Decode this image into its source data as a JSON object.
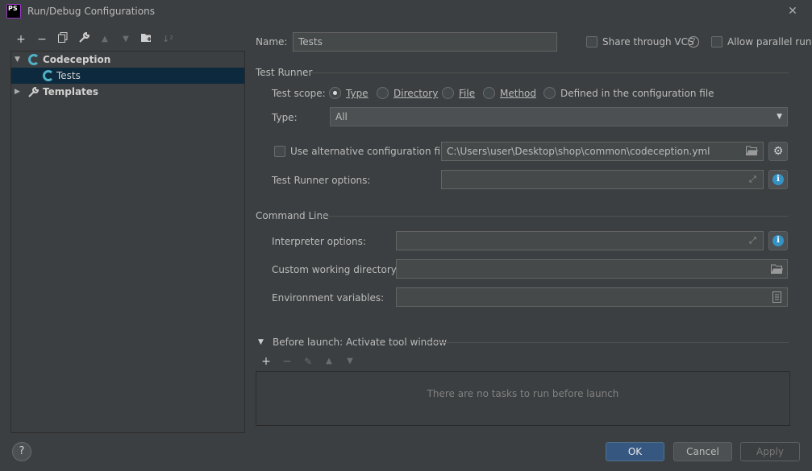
{
  "window": {
    "title": "Run/Debug Configurations",
    "logo_text": "PS"
  },
  "toolbar": {
    "icons": [
      "add-icon",
      "remove-icon",
      "copy-icon",
      "wrench-icon",
      "move-up-icon",
      "move-down-icon",
      "new-folder-icon",
      "sort-icon"
    ]
  },
  "tree": {
    "items": [
      {
        "label": "Codeception",
        "level": 0,
        "expanded": true
      },
      {
        "label": "Tests",
        "level": 1,
        "selected": true
      },
      {
        "label": "Templates",
        "level": 0,
        "expanded": false
      }
    ]
  },
  "config": {
    "name_label": "Name:",
    "name_value": "Tests",
    "share_vcs_label": "Share through VCS",
    "allow_parallel_label": "Allow parallel run"
  },
  "test_runner": {
    "section_title": "Test Runner",
    "scope_label": "Test scope:",
    "scope_options": [
      {
        "label": "Type",
        "checked": true
      },
      {
        "label": "Directory",
        "checked": false
      },
      {
        "label": "File",
        "checked": false
      },
      {
        "label": "Method",
        "checked": false
      },
      {
        "label": "Defined in the configuration file",
        "checked": false
      }
    ],
    "type_label": "Type:",
    "type_value": "All",
    "alt_config_label": "Use alternative configuration file:",
    "alt_config_value": "C:\\Users\\user\\Desktop\\shop\\common\\codeception.yml",
    "options_label": "Test Runner options:",
    "options_value": ""
  },
  "command_line": {
    "section_title": "Command Line",
    "interpreter_label": "Interpreter options:",
    "interpreter_value": "",
    "workdir_label": "Custom working directory:",
    "workdir_value": "",
    "env_label": "Environment variables:",
    "env_value": ""
  },
  "before_launch": {
    "title": "Before launch: Activate tool window",
    "empty_text": "There are no tasks to run before launch"
  },
  "buttons": {
    "ok": "OK",
    "cancel": "Cancel",
    "apply": "Apply",
    "help": "?"
  },
  "colors": {
    "background": "#3c3f41",
    "selection": "#0d293e",
    "accent": "#365880",
    "codeception_icon": "#4fb0c6"
  }
}
